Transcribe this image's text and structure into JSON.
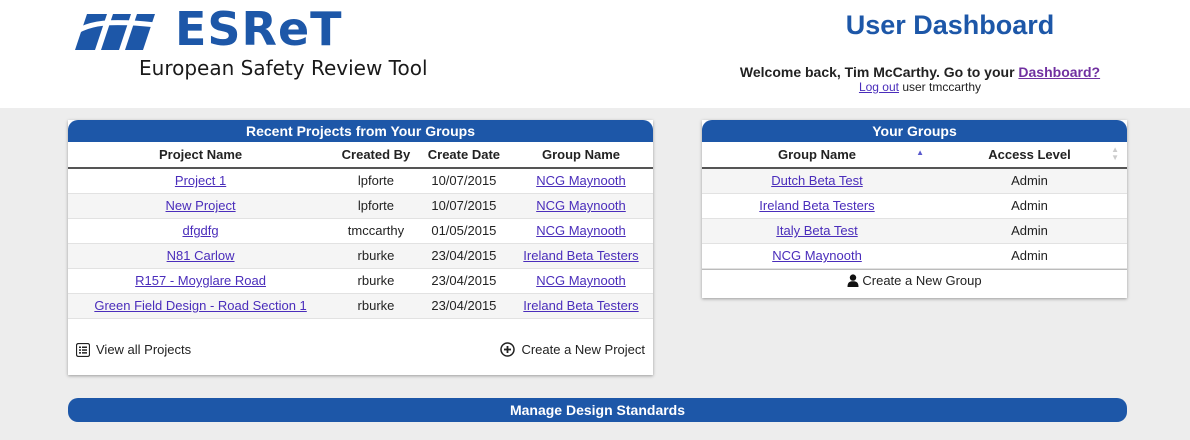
{
  "header": {
    "logo_text": "ESReT",
    "logo_subtitle": "European Safety Review Tool",
    "page_title": "User Dashboard",
    "welcome_text": "Welcome back, Tim McCarthy. Go to your ",
    "dashboard_link": "Dashboard?",
    "logout_link": "Log out",
    "logout_suffix": " user tmccarthy"
  },
  "recent_projects": {
    "title": "Recent Projects from Your Groups",
    "columns": [
      "Project Name",
      "Created By",
      "Create Date",
      "Group Name"
    ],
    "rows": [
      {
        "name": "Project 1",
        "created_by": "lpforte",
        "date": "10/07/2015",
        "group": "NCG Maynooth"
      },
      {
        "name": "New Project",
        "created_by": "lpforte",
        "date": "10/07/2015",
        "group": "NCG Maynooth"
      },
      {
        "name": "dfgdfg",
        "created_by": "tmccarthy",
        "date": "01/05/2015",
        "group": "NCG Maynooth"
      },
      {
        "name": "N81 Carlow",
        "created_by": "rburke",
        "date": "23/04/2015",
        "group": "Ireland Beta Testers"
      },
      {
        "name": "R157 - Moyglare Road",
        "created_by": "rburke",
        "date": "23/04/2015",
        "group": "NCG Maynooth"
      },
      {
        "name": "Green Field Design - Road Section 1",
        "created_by": "rburke",
        "date": "23/04/2015",
        "group": "Ireland Beta Testers"
      }
    ],
    "view_all_label": "View all Projects",
    "create_label": "Create a New Project"
  },
  "your_groups": {
    "title": "Your Groups",
    "columns": [
      "Group Name",
      "Access Level"
    ],
    "rows": [
      {
        "name": "Dutch Beta Test",
        "access": "Admin"
      },
      {
        "name": "Ireland Beta Testers",
        "access": "Admin"
      },
      {
        "name": "Italy Beta Test",
        "access": "Admin"
      },
      {
        "name": "NCG Maynooth",
        "access": "Admin"
      }
    ],
    "create_label": "Create a New Group"
  },
  "manage_design_standards": "Manage Design Standards",
  "icons": {
    "list": "list-icon",
    "plus_circle": "plus-circle-icon",
    "user": "user-icon",
    "sort_up": "sort-up-icon",
    "sort_both": "sort-both-icon"
  },
  "colors": {
    "brand_blue": "#1d57a8",
    "link": "#4a2dbb",
    "link_visited": "#7030a0",
    "background": "#ededed"
  }
}
